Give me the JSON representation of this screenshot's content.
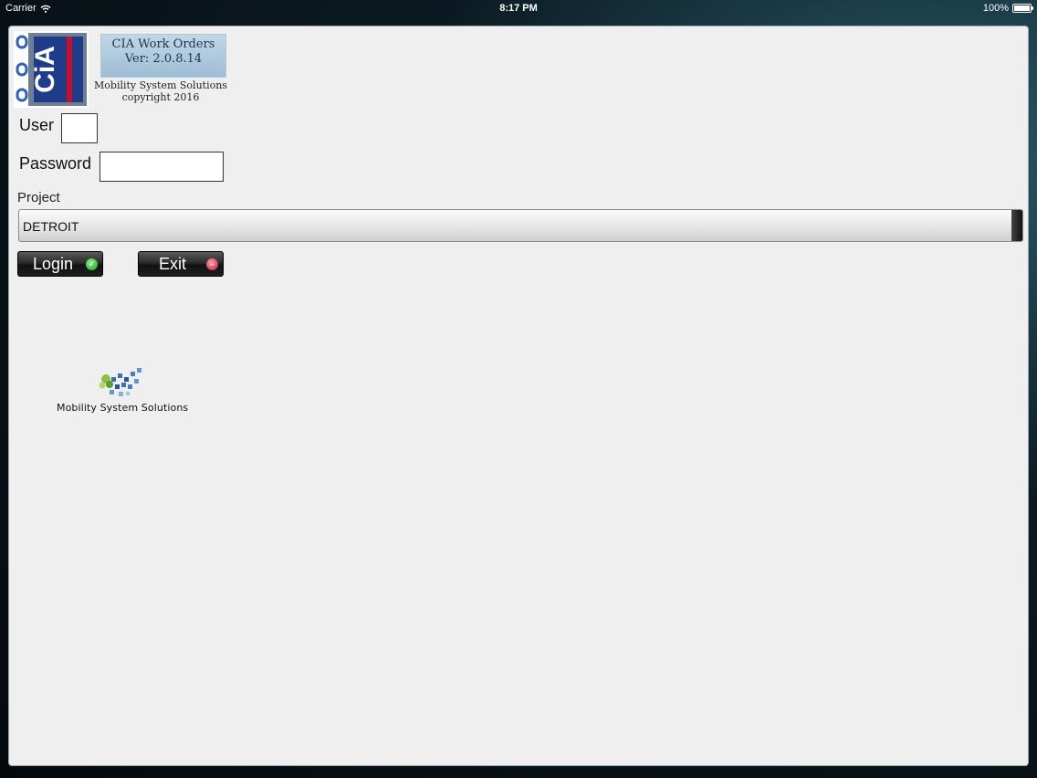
{
  "status_bar": {
    "carrier": "Carrier",
    "time": "8:17 PM",
    "battery": "100%"
  },
  "app": {
    "logo_text": "CiA",
    "title": "CIA Work Orders",
    "version": "Ver: 2.0.8.14",
    "company": "Mobility System Solutions",
    "copyright": "copyright 2016"
  },
  "form": {
    "user_label": "User",
    "user_value": "",
    "password_label": "Password",
    "password_value": "",
    "project_label": "Project",
    "project_value": "DETROIT"
  },
  "buttons": {
    "login": "Login",
    "exit": "Exit"
  },
  "footer_logo": {
    "text": "Mobility System Solutions"
  },
  "colors": {
    "version_bg": "#9fbdd6",
    "login_icon": "#1a9a1a",
    "exit_icon": "#b01d33",
    "logo_blue": "#1f3c88",
    "logo_red": "#c8102e"
  }
}
